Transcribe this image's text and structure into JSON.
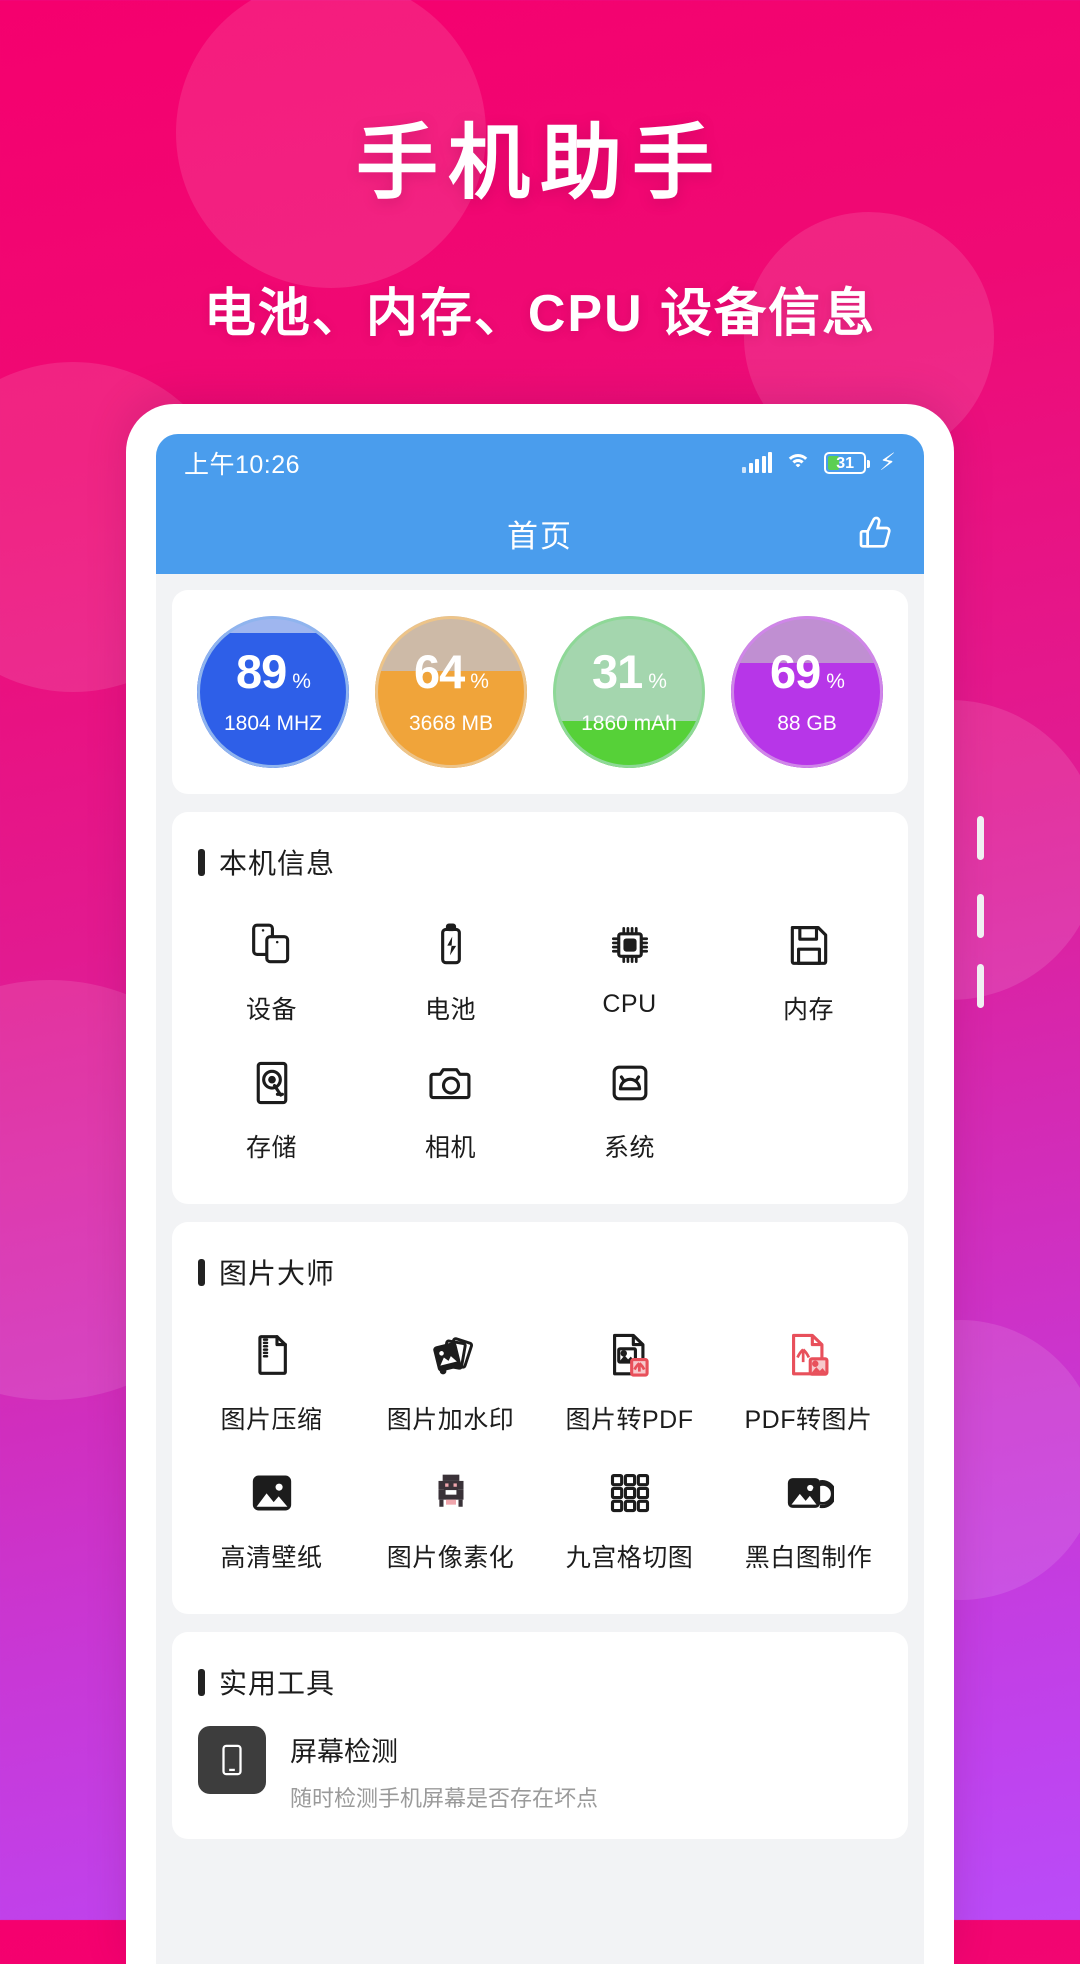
{
  "hero": {
    "title": "手机助手",
    "subtitle": "电池、内存、CPU 设备信息"
  },
  "colors": {
    "bg_start": "#f5006e",
    "bg_end": "#b94cf8",
    "appbar": "#4a9ded",
    "card": "#ffffff",
    "page": "#f2f3f5",
    "accent_cpu": "#2e5fe8",
    "accent_ram": "#f0a43a",
    "accent_batt": "#56d138",
    "accent_storage": "#b736e8",
    "pdf_red": "#e8505b"
  },
  "statusbar": {
    "time": "上午10:26",
    "signal_icon": "signal-bars-icon",
    "wifi_icon": "wifi-icon",
    "battery_icon": "battery-icon",
    "battery_level": "31",
    "battery_percent": 31,
    "charging_icon": "charging-bolt-icon"
  },
  "appbar": {
    "title": "首页",
    "action_icon": "thumbs-up-icon"
  },
  "gauges": [
    {
      "value": "89",
      "unit": "%",
      "sub": "1804 MHZ",
      "fill": 89,
      "color": "#2e5fe8",
      "light": "#9fb6ef",
      "ring": "#8fb4ee",
      "name": "cpu-gauge"
    },
    {
      "value": "64",
      "unit": "%",
      "sub": "3668 MB",
      "fill": 64,
      "color": "#f0a43a",
      "light": "#cdbaa7",
      "ring": "#edc489",
      "name": "memory-gauge"
    },
    {
      "value": "31",
      "unit": "%",
      "sub": "1860 mAh",
      "fill": 31,
      "color": "#56d138",
      "light": "#a4d6ae",
      "ring": "#8ed897",
      "name": "battery-gauge"
    },
    {
      "value": "69",
      "unit": "%",
      "sub": "88 GB",
      "fill": 69,
      "color": "#b736e8",
      "light": "#c08fd2",
      "ring": "#cf86e8",
      "name": "storage-gauge"
    }
  ],
  "sections": [
    {
      "title": "本机信息",
      "name": "device-info-section",
      "items": [
        {
          "label": "设备",
          "icon": "phone-device-icon"
        },
        {
          "label": "电池",
          "icon": "battery-icon"
        },
        {
          "label": "CPU",
          "icon": "cpu-chip-icon"
        },
        {
          "label": "内存",
          "icon": "floppy-disk-icon"
        },
        {
          "label": "存储",
          "icon": "hard-drive-icon"
        },
        {
          "label": "相机",
          "icon": "camera-icon"
        },
        {
          "label": "系统",
          "icon": "android-system-icon"
        }
      ]
    },
    {
      "title": "图片大师",
      "name": "image-master-section",
      "items": [
        {
          "label": "图片压缩",
          "icon": "compress-file-icon"
        },
        {
          "label": "图片加水印",
          "icon": "watermark-photos-icon"
        },
        {
          "label": "图片转PDF",
          "icon": "image-to-pdf-icon"
        },
        {
          "label": "PDF转图片",
          "icon": "pdf-to-image-icon"
        },
        {
          "label": "高清壁纸",
          "icon": "wallpaper-image-icon"
        },
        {
          "label": "图片像素化",
          "icon": "pixelate-icon"
        },
        {
          "label": "九宫格切图",
          "icon": "nine-grid-icon"
        },
        {
          "label": "黑白图制作",
          "icon": "black-white-photo-icon"
        }
      ]
    },
    {
      "title": "实用工具",
      "name": "utility-tools-section",
      "tools": [
        {
          "name": "屏幕检测",
          "desc": "随时检测手机屏幕是否存在坏点",
          "icon": "screen-test-icon"
        }
      ]
    }
  ]
}
